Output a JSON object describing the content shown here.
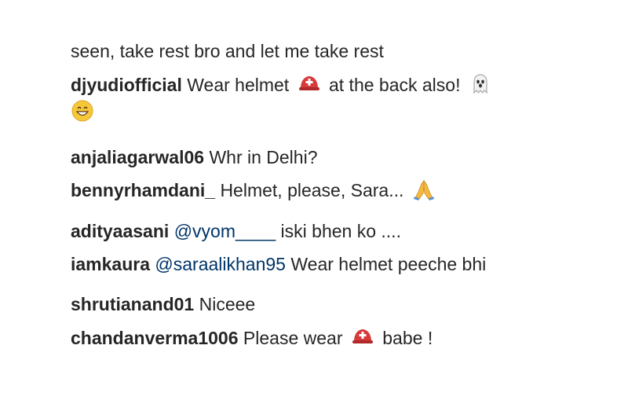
{
  "comments": [
    {
      "text_before": "seen, take rest bro and let me take rest"
    },
    {
      "username": "djyudiofficial",
      "text_before": "Wear helmet",
      "emoji1": "helmet-emoji",
      "text_after": "at the back also!",
      "emoji2": "ghost-emoji",
      "emoji3": "grinning-face-emoji"
    },
    {
      "username": "anjaliagarwal06",
      "text_before": "Whr in Delhi?"
    },
    {
      "username": "bennyrhamdani_",
      "text_before": "Helmet, please, Sara...",
      "emoji1": "folded-hands-emoji"
    },
    {
      "username": "adityaasani",
      "mention": "@vyom____",
      "text_after": "iski bhen ko ...."
    },
    {
      "username": "iamkaura",
      "mention": "@saraalikhan95",
      "text_after": "Wear helmet peeche bhi"
    },
    {
      "username": "shrutianand01",
      "text_before": "Niceee"
    },
    {
      "username": "chandanverma1006",
      "text_before": "Please wear",
      "emoji1": "helmet-emoji",
      "text_after": "babe !"
    }
  ],
  "colors": {
    "text": "#262626",
    "mention": "#003569",
    "background": "#ffffff"
  }
}
